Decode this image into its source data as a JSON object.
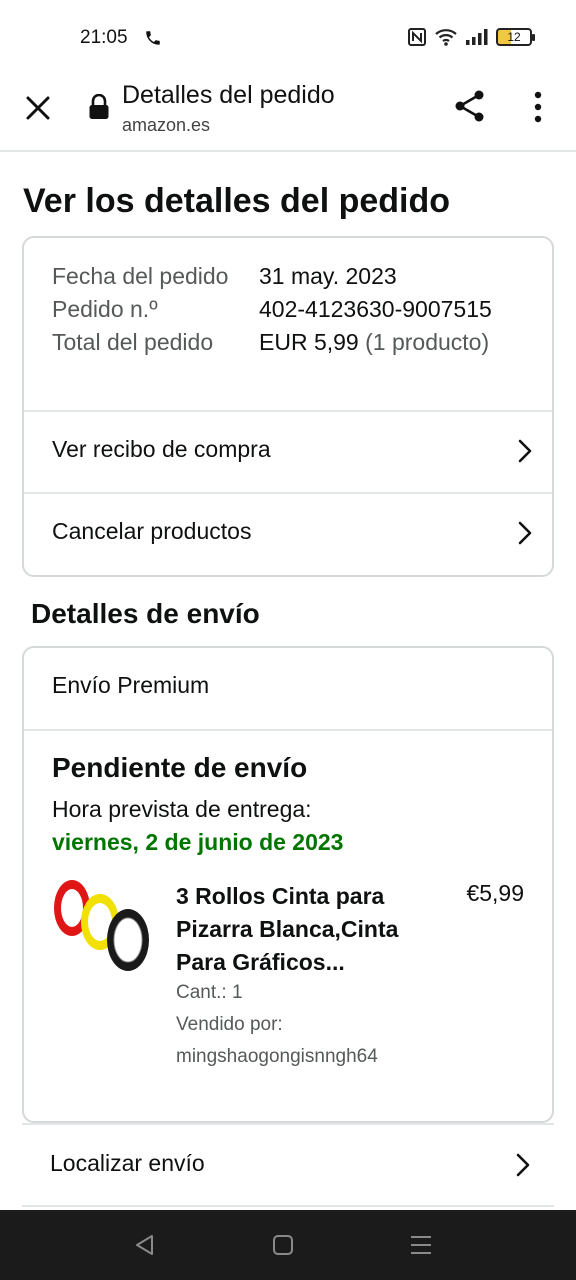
{
  "status_bar": {
    "time": "21:05",
    "battery": "12",
    "icons": [
      "phone-icon",
      "nfc-icon",
      "wifi-icon",
      "signal-icon",
      "battery-icon"
    ]
  },
  "toolbar": {
    "title": "Detalles del pedido",
    "url": "amazon.es",
    "icons": [
      "close-icon",
      "lock-icon",
      "share-icon",
      "more-vert-icon"
    ]
  },
  "page": {
    "title": "Ver los detalles del pedido"
  },
  "order": {
    "date_label": "Fecha del pedido",
    "date_value": "31 may. 2023",
    "number_label": "Pedido n.º",
    "number_value": "402-4123630-9007515",
    "total_label": "Total del pedido",
    "total_value": "EUR 5,99",
    "total_count": "(1 producto)",
    "links": [
      {
        "label": "Ver recibo de compra"
      },
      {
        "label": "Cancelar productos"
      }
    ]
  },
  "shipping": {
    "section_title": "Detalles de envío",
    "type": "Envío Premium",
    "status": "Pendiente de envío",
    "eta_label": "Hora prevista de entrega:",
    "eta_date": "viernes, 2 de junio de 2023",
    "eta_color": "#007600",
    "product": {
      "name": "3 Rollos Cinta para Pizarra Blanca,Cinta Para Gráficos...",
      "price": "€5,99",
      "qty": "Cant.: 1",
      "seller_label": "Vendido por:",
      "seller": "mingshaogongisnngh64"
    },
    "track_label": "Localizar envío"
  },
  "nav": {
    "icons": [
      "back-icon",
      "home-icon",
      "recents-icon"
    ]
  }
}
